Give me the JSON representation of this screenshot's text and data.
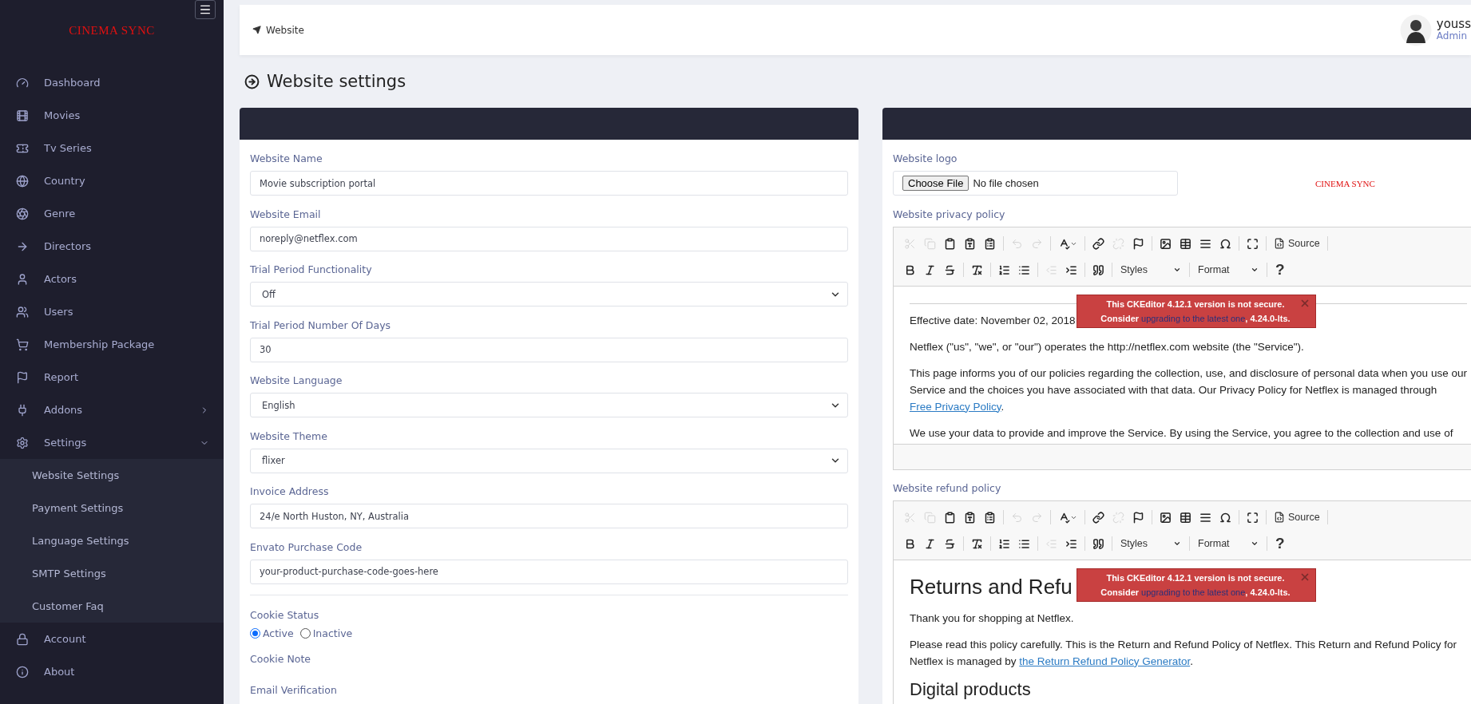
{
  "sidebar": {
    "logo": "CINEMA SYNC",
    "items": [
      {
        "label": "Dashboard"
      },
      {
        "label": "Movies"
      },
      {
        "label": "Tv Series"
      },
      {
        "label": "Country"
      },
      {
        "label": "Genre"
      },
      {
        "label": "Directors"
      },
      {
        "label": "Actors"
      },
      {
        "label": "Users"
      },
      {
        "label": "Membership Package"
      },
      {
        "label": "Report"
      },
      {
        "label": "Addons",
        "expanded": false
      },
      {
        "label": "Settings",
        "expanded": true,
        "children": [
          {
            "label": "Website Settings"
          },
          {
            "label": "Payment Settings"
          },
          {
            "label": "Language Settings"
          },
          {
            "label": "SMTP Settings"
          },
          {
            "label": "Customer Faq"
          }
        ]
      },
      {
        "label": "Account"
      },
      {
        "label": "About"
      }
    ]
  },
  "topbar": {
    "breadcrumb": "Website",
    "user": {
      "name": "youss",
      "role": "Admin"
    }
  },
  "page_title": "Website settings",
  "settings_form": {
    "fields": [
      {
        "kind": "text",
        "label": "Website Name",
        "value": "Movie subscription portal"
      },
      {
        "kind": "text",
        "label": "Website Email",
        "value": "noreply@netflex.com"
      },
      {
        "kind": "select",
        "label": "Trial Period Functionality",
        "value": "Off"
      },
      {
        "kind": "text",
        "label": "Trial Period Number Of Days",
        "value": "30"
      },
      {
        "kind": "select",
        "label": "Website Language",
        "value": "English"
      },
      {
        "kind": "select",
        "label": "Website Theme",
        "value": "flixer"
      },
      {
        "kind": "text",
        "label": "Invoice Address",
        "value": "24/e North Huston, NY, Australia"
      },
      {
        "kind": "text",
        "label": "Envato Purchase Code",
        "value": "your-product-purchase-code-goes-here"
      },
      {
        "kind": "divider"
      },
      {
        "kind": "radio",
        "label": "Cookie Status",
        "options": [
          {
            "label": "Active",
            "selected": true
          },
          {
            "label": "Inactive",
            "selected": false
          }
        ]
      },
      {
        "kind": "heading",
        "label": "Cookie Note"
      },
      {
        "kind": "heading",
        "label": "Email Verification"
      }
    ]
  },
  "site_panel": {
    "logo_field": {
      "label": "Website logo",
      "button": "Choose File",
      "status": "No file chosen",
      "preview": "CINEMA SYNC"
    },
    "editors": [
      {
        "label": "Website privacy policy",
        "toolbar": {
          "source": "Source",
          "styles": "Styles",
          "format": "Format",
          "help": "?",
          "tools": [
            {
              "disabled": true
            },
            {
              "disabled": true
            },
            {
              "disabled": false
            },
            {
              "disabled": false
            },
            {
              "disabled": false
            },
            {
              "disabled": true
            },
            {
              "disabled": true
            },
            {
              "disabled": false
            },
            {
              "disabled": false
            },
            {
              "disabled": true
            },
            {
              "disabled": false
            },
            {
              "disabled": false
            },
            {
              "disabled": false
            },
            {
              "disabled": false
            },
            {
              "disabled": false
            },
            {
              "disabled": false
            },
            {
              "disabled": false
            },
            {
              "disabled": false
            },
            {
              "disabled": false
            },
            {
              "disabled": false
            },
            {
              "disabled": false
            },
            {
              "disabled": false
            },
            {
              "disabled": true
            },
            {
              "disabled": false
            },
            {
              "disabled": false
            }
          ]
        },
        "content": [
          {
            "kind": "rule"
          },
          {
            "kind": "p",
            "text": "Effective date: November 02, 2018"
          },
          {
            "kind": "p",
            "text": "Netflex (\"us\", \"we\", or \"our\") operates the http://netflex.com website (the \"Service\")."
          },
          {
            "kind": "p",
            "text": "This page informs you of our policies regarding the collection, use, and disclosure of personal data when you use our Service and the choices you have associated with that data. Our Privacy Policy for Netflex is managed through ",
            "link": "Free Privacy Policy",
            "after": "."
          },
          {
            "kind": "p",
            "text": "We use your data to provide and improve the Service. By using the Service, you agree to the collection and use of"
          }
        ],
        "warning": {
          "title": "This CKEditor 4.12.1 version is not secure.",
          "before": "Consider ",
          "link": "upgrading to the latest one",
          "after": ", 4.24.0-lts."
        }
      },
      {
        "label": "Website refund policy",
        "toolbar": {
          "source": "Source",
          "styles": "Styles",
          "format": "Format",
          "help": "?",
          "tools": [
            {
              "disabled": true
            },
            {
              "disabled": true
            },
            {
              "disabled": false
            },
            {
              "disabled": false
            },
            {
              "disabled": false
            },
            {
              "disabled": true
            },
            {
              "disabled": true
            },
            {
              "disabled": false
            },
            {
              "disabled": false
            },
            {
              "disabled": true
            },
            {
              "disabled": false
            },
            {
              "disabled": false
            },
            {
              "disabled": false
            },
            {
              "disabled": false
            },
            {
              "disabled": false
            },
            {
              "disabled": false
            },
            {
              "disabled": false
            },
            {
              "disabled": false
            },
            {
              "disabled": false
            },
            {
              "disabled": false
            },
            {
              "disabled": false
            },
            {
              "disabled": false
            },
            {
              "disabled": true
            },
            {
              "disabled": false
            },
            {
              "disabled": false
            }
          ]
        },
        "content": [
          {
            "kind": "h1",
            "text": "Returns and Refu"
          },
          {
            "kind": "p",
            "text": "Thank you for shopping at Netflex."
          },
          {
            "kind": "p",
            "text": "Please read this policy carefully. This is the Return and Refund Policy of Netflex. This Return and Refund Policy for Netflex is managed by ",
            "link": "the Return Refund Policy Generator",
            "after": "."
          },
          {
            "kind": "h2",
            "text": "Digital products"
          }
        ],
        "warning": {
          "title": "This CKEditor 4.12.1 version is not secure.",
          "before": "Consider ",
          "link": "upgrading to the latest one",
          "after": ", 4.24.0-lts."
        }
      }
    ]
  }
}
